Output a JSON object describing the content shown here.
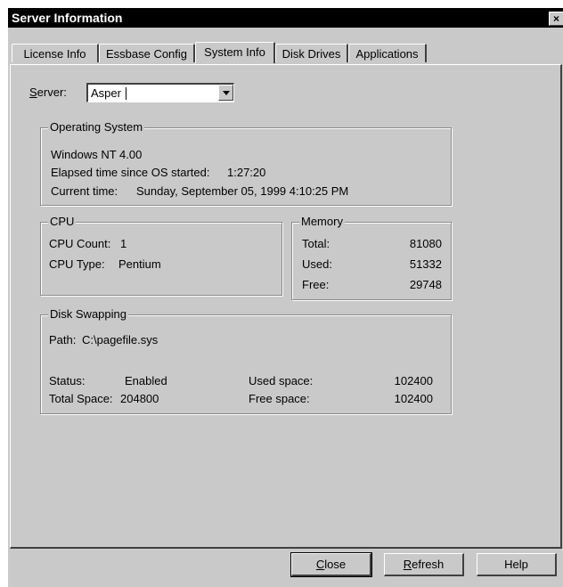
{
  "window": {
    "title": "Server Information",
    "close_label": "×"
  },
  "tabs": [
    {
      "label": "License Info",
      "active": false
    },
    {
      "label": "Essbase Config",
      "active": false
    },
    {
      "label": "System Info",
      "active": true
    },
    {
      "label": "Disk Drives",
      "active": false
    },
    {
      "label": "Applications",
      "active": false
    }
  ],
  "server": {
    "label_first": "S",
    "label_rest": "erver:",
    "value": "Asper"
  },
  "os": {
    "title": "Operating System",
    "name": "Windows NT 4.00",
    "elapsed_label": "Elapsed time since OS started:",
    "elapsed_value": "1:27:20",
    "current_label": "Current time:",
    "current_value": "Sunday, September 05, 1999 4:10:25 PM"
  },
  "cpu": {
    "title": "CPU",
    "count_label": "CPU Count:",
    "count_value": "1",
    "type_label": "CPU Type:",
    "type_value": "Pentium"
  },
  "memory": {
    "title": "Memory",
    "total_label": "Total:",
    "total_value": "81080",
    "used_label": "Used:",
    "used_value": "51332",
    "free_label": "Free:",
    "free_value": "29748"
  },
  "swap": {
    "title": "Disk Swapping",
    "path_label": "Path:",
    "path_value": "C:\\pagefile.sys",
    "status_label": "Status:",
    "status_value": "Enabled",
    "total_label": "Total Space:",
    "total_value": "204800",
    "used_label": "Used space:",
    "used_value": "102400",
    "free_label": "Free space:",
    "free_value": "102400"
  },
  "buttons": {
    "close_first": "C",
    "close_rest": "lose",
    "refresh_first": "R",
    "refresh_rest": "efresh",
    "help": "Help"
  }
}
